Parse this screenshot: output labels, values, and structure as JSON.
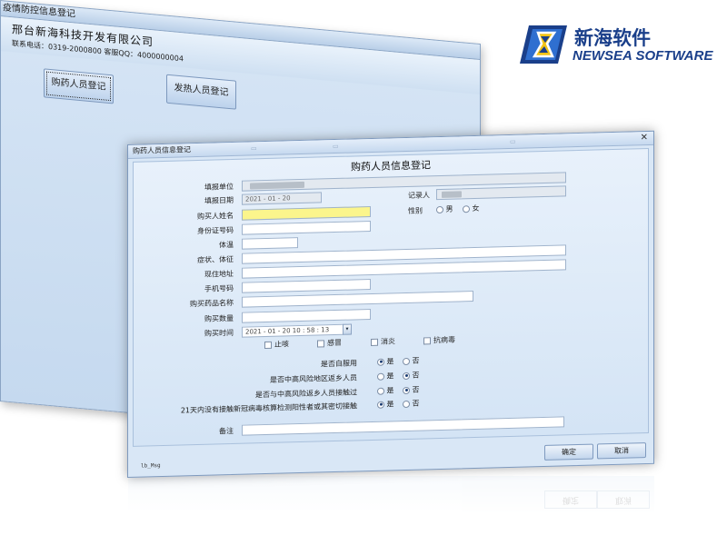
{
  "brand": {
    "name_cn": "新海软件",
    "name_en": "NEWSEA SOFTWARE",
    "colors": {
      "primary": "#1a3f8a",
      "accent": "#f3c316"
    }
  },
  "back_window": {
    "title": "疫情防控信息登记",
    "company": "邢台新海科技开发有限公司",
    "contact": "联系电话：0319-2000800 客服QQ：4000000004",
    "buttons": {
      "register": "购药人员登记",
      "fever": "发热人员登记"
    }
  },
  "form": {
    "window_title": "购药人员信息登记",
    "heading": "购药人员信息登记",
    "close_label": "✕",
    "fields": {
      "unit": {
        "label": "填报单位"
      },
      "date": {
        "label": "填报日期",
        "value": "2021 - 01 - 20"
      },
      "recorder": {
        "label": "记录人"
      },
      "buyer_name": {
        "label": "购买人姓名"
      },
      "gender": {
        "label": "性别",
        "options": [
          "男",
          "女"
        ]
      },
      "id_number": {
        "label": "身份证号码"
      },
      "temperature": {
        "label": "体温"
      },
      "symptoms": {
        "label": "症状、体征"
      },
      "address": {
        "label": "现住地址"
      },
      "phone": {
        "label": "手机号码"
      },
      "drug_name": {
        "label": "购买药品名称"
      },
      "quantity": {
        "label": "购买数量"
      },
      "purchase_time": {
        "label": "购买时间",
        "value": "2021 - 01 - 20    10 : 58 : 13"
      },
      "remark": {
        "label": "备注"
      }
    },
    "drug_types": [
      "止咳",
      "感冒",
      "消炎",
      "抗病毒"
    ],
    "questions": [
      {
        "label": "是否自服用",
        "yes": "是",
        "no": "否",
        "selected": "yes"
      },
      {
        "label": "是否中高风险地区返乡人员",
        "yes": "是",
        "no": "否",
        "selected": "no"
      },
      {
        "label": "是否与中高风险返乡人员接触过",
        "yes": "是",
        "no": "否",
        "selected": "no"
      },
      {
        "label": "21天内没有接触新冠病毒核算检测阳性者或其密切接触",
        "yes": "是",
        "no": "否",
        "selected": "yes"
      }
    ],
    "status_text": "lb_Msg",
    "buttons": {
      "ok": "确定",
      "cancel": "取消"
    }
  }
}
